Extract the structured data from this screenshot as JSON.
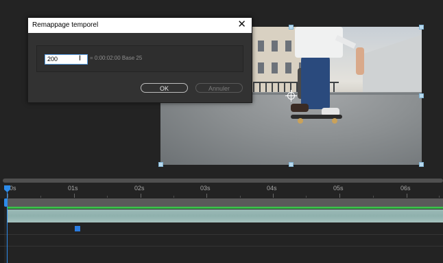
{
  "dialog": {
    "title": "Remappage temporel",
    "close_symbol": "✕",
    "frames_value": "200",
    "timecode_equivalent": "= 0:00:02:00  Base 25",
    "ok_label": "OK",
    "cancel_label": "Annuler"
  },
  "timeline": {
    "ticks": [
      "00s",
      "01s",
      "02s",
      "03s",
      "04s",
      "05s",
      "06s"
    ]
  },
  "colors": {
    "accent": "#2d8ceb",
    "layer": "#9bb9b6",
    "layer_top": "#3bbf4a",
    "keyframe": "#2a7ce0",
    "background": "#232323"
  }
}
